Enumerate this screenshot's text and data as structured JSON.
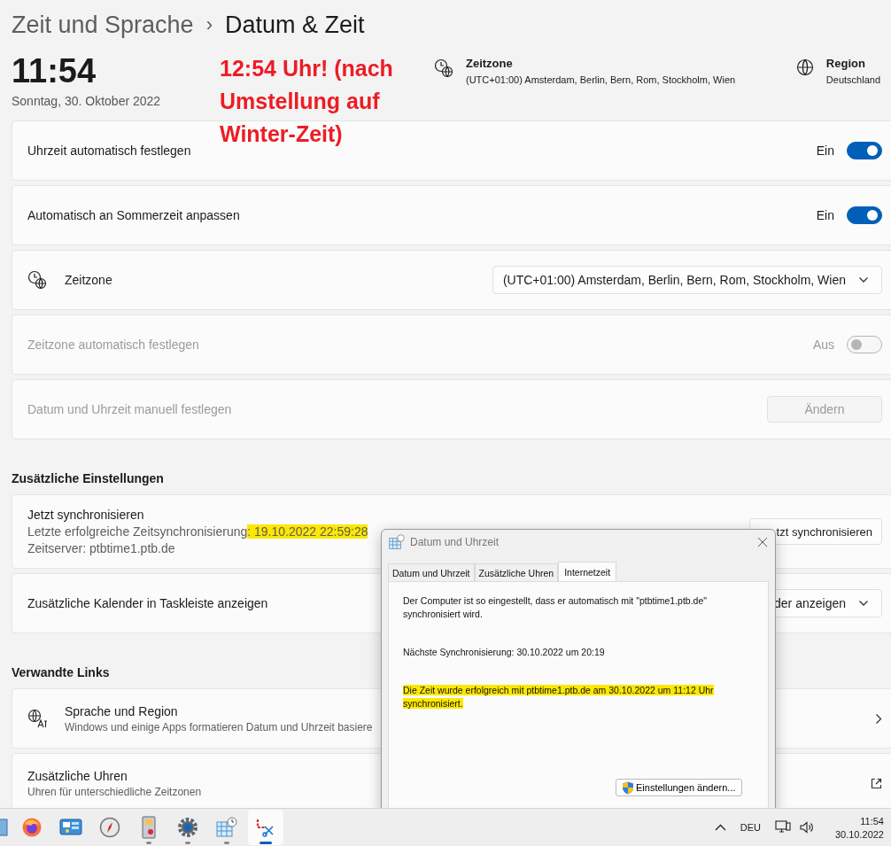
{
  "breadcrumb": {
    "parent": "Zeit und Sprache",
    "separator": "›",
    "current": "Datum & Zeit"
  },
  "clock": {
    "time": "11:54",
    "date": "Sonntag, 30. Oktober 2022"
  },
  "annotation": {
    "text": "12:54 Uhr! (nach Umstellung auf Winter-Zeit)"
  },
  "info": [
    {
      "kind": "timezone",
      "title": "Zeitzone",
      "value": "(UTC+01:00) Amsterdam, Berlin, Bern, Rom, Stockholm, Wien"
    },
    {
      "kind": "region",
      "title": "Region",
      "value": "Deutschland"
    }
  ],
  "settings": [
    {
      "kind": "toggle",
      "label": "Uhrzeit automatisch festlegen",
      "state_text": "Ein",
      "on": true,
      "disabled": false
    },
    {
      "kind": "toggle",
      "label": "Automatisch an Sommerzeit anpassen",
      "state_text": "Ein",
      "on": true,
      "disabled": false
    },
    {
      "kind": "timezone",
      "label": "Zeitzone",
      "value": "(UTC+01:00) Amsterdam, Berlin, Bern, Rom, Stockholm, Wien"
    },
    {
      "kind": "toggle",
      "label": "Zeitzone automatisch festlegen",
      "state_text": "Aus",
      "on": false,
      "disabled": true
    },
    {
      "kind": "button",
      "label": "Datum und Uhrzeit manuell festlegen",
      "button": "Ändern",
      "disabled": true
    }
  ],
  "additional": {
    "title": "Zusätzliche Einstellungen",
    "items": [
      {
        "kind": "sync",
        "title": "Jetzt synchronisieren",
        "lines": [
          [
            {
              "text": "Letzte erfolgreiche Zeitsynchronisierung",
              "highlighted": false
            },
            {
              "text": ": 19.10.2022 22:59:28",
              "highlighted": true
            }
          ],
          [
            {
              "text": "Zeitserver: ptbtime1.ptb.de",
              "highlighted": false
            }
          ]
        ],
        "button": "tzt synchronisieren"
      },
      {
        "kind": "dropdown",
        "label": "Zusätzliche Kalender in Taskleiste anzeigen",
        "value": "der anzeigen"
      }
    ]
  },
  "links": {
    "title": "Verwandte Links",
    "items": [
      {
        "kind": "language",
        "title": "Sprache und Region",
        "subtitle": "Windows und einige Apps formatieren Datum und Uhrzeit basiere"
      },
      {
        "kind": "external",
        "title": "Zusätzliche Uhren",
        "subtitle": "Uhren für unterschiedliche Zeitzonen"
      }
    ]
  },
  "dialog": {
    "title": "Datum und Uhrzeit",
    "tabs": [
      {
        "label": "Datum und Uhrzeit",
        "selected": false
      },
      {
        "label": "Zusätzliche Uhren",
        "selected": false
      },
      {
        "label": "Internetzeit",
        "selected": true
      }
    ],
    "paragraphs": [
      {
        "text": "Der Computer ist so eingestellt, dass er automatisch mit \"ptbtime1.ptb.de\" synchronisiert wird.",
        "highlighted": false
      },
      {
        "text": "Nächste Synchronisierung: 30.10.2022 um 20:19",
        "highlighted": false
      },
      {
        "text": "Die Zeit wurde erfolgreich mit ptbtime1.ptb.de am 30.10.2022 um 11:12 Uhr synchronisiert.",
        "highlighted": true
      }
    ],
    "button": "Einstellungen ändern..."
  },
  "taskbar": {
    "apps": [
      {
        "kind": "file",
        "running": false,
        "selected": false
      },
      {
        "kind": "browser",
        "running": false,
        "selected": false
      },
      {
        "kind": "panel",
        "running": false,
        "selected": false
      },
      {
        "kind": "compass",
        "running": false,
        "selected": false
      },
      {
        "kind": "shredder",
        "running": true,
        "selected": false
      },
      {
        "kind": "settings",
        "running": true,
        "selected": false
      },
      {
        "kind": "calendar",
        "running": true,
        "selected": false
      },
      {
        "kind": "snip",
        "running": true,
        "selected": true
      }
    ],
    "language": "DEU",
    "time": "11:54",
    "date": "30.10.2022"
  }
}
